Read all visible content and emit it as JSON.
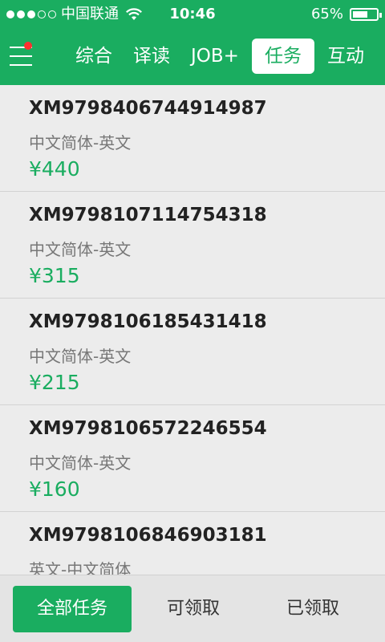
{
  "status_bar": {
    "carrier": "中国联通",
    "time": "10:46",
    "battery": "65%",
    "battery_level": 0.65
  },
  "nav": {
    "tabs": [
      {
        "label": "综合"
      },
      {
        "label": "译读"
      },
      {
        "label": "JOB+"
      },
      {
        "label": "任务",
        "active": true
      },
      {
        "label": "互动"
      }
    ]
  },
  "tasks": [
    {
      "id": "XM9798406744914987",
      "lang": "中文简体-英文",
      "price": "¥440"
    },
    {
      "id": "XM9798107114754318",
      "lang": "中文简体-英文",
      "price": "¥315"
    },
    {
      "id": "XM9798106185431418",
      "lang": "中文简体-英文",
      "price": "¥215"
    },
    {
      "id": "XM9798106572246554",
      "lang": "中文简体-英文",
      "price": "¥160"
    },
    {
      "id": "XM9798106846903181",
      "lang": "英文-中文简体",
      "price": ""
    }
  ],
  "bottom_tabs": [
    {
      "label": "全部任务",
      "active": true
    },
    {
      "label": "可领取"
    },
    {
      "label": "已领取"
    }
  ],
  "colors": {
    "accent": "#1aad60",
    "notification_dot": "#ff3030"
  }
}
